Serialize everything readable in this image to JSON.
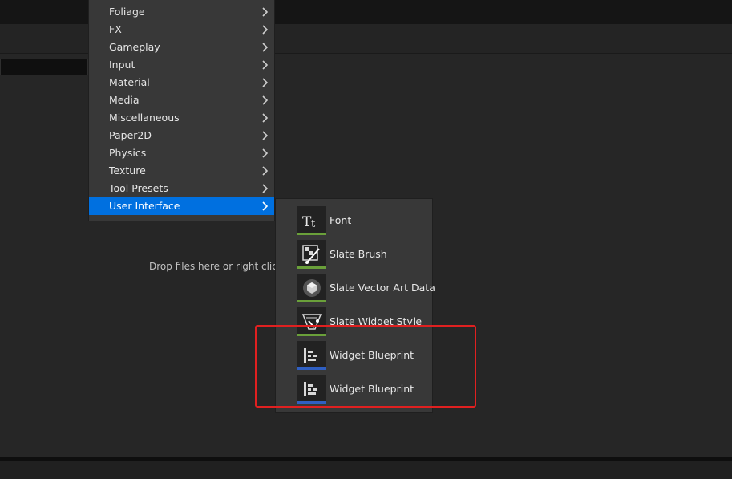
{
  "colors": {
    "active_item_bg": "#0070e0",
    "highlight_box": "#e02020",
    "stripe_green": "#6aa03a",
    "stripe_blue": "#2f5fc2"
  },
  "content_browser": {
    "drop_hint": "Drop files here or right click"
  },
  "category_menu": {
    "items": [
      {
        "label": "Foliage",
        "icon": "chevron-right-icon"
      },
      {
        "label": "FX",
        "icon": "chevron-right-icon"
      },
      {
        "label": "Gameplay",
        "icon": "chevron-right-icon"
      },
      {
        "label": "Input",
        "icon": "chevron-right-icon"
      },
      {
        "label": "Material",
        "icon": "chevron-right-icon"
      },
      {
        "label": "Media",
        "icon": "chevron-right-icon"
      },
      {
        "label": "Miscellaneous",
        "icon": "chevron-right-icon"
      },
      {
        "label": "Paper2D",
        "icon": "chevron-right-icon"
      },
      {
        "label": "Physics",
        "icon": "chevron-right-icon"
      },
      {
        "label": "Texture",
        "icon": "chevron-right-icon"
      },
      {
        "label": "Tool Presets",
        "icon": "chevron-right-icon"
      },
      {
        "label": "User Interface",
        "icon": "chevron-right-icon",
        "selected": true
      }
    ]
  },
  "user_interface_submenu": {
    "items": [
      {
        "label": "Font",
        "icon": "font-icon",
        "stripe": "green"
      },
      {
        "label": "Slate Brush",
        "icon": "slate-brush-icon",
        "stripe": "green"
      },
      {
        "label": "Slate Vector Art Data",
        "icon": "vector-art-icon",
        "stripe": "green"
      },
      {
        "label": "Slate Widget Style",
        "icon": "widget-style-icon",
        "stripe": "green"
      },
      {
        "label": "Widget Blueprint",
        "icon": "widget-blueprint-icon",
        "stripe": "blue"
      },
      {
        "label": "Widget Blueprint",
        "icon": "widget-blueprint-icon",
        "stripe": "blue"
      }
    ]
  }
}
